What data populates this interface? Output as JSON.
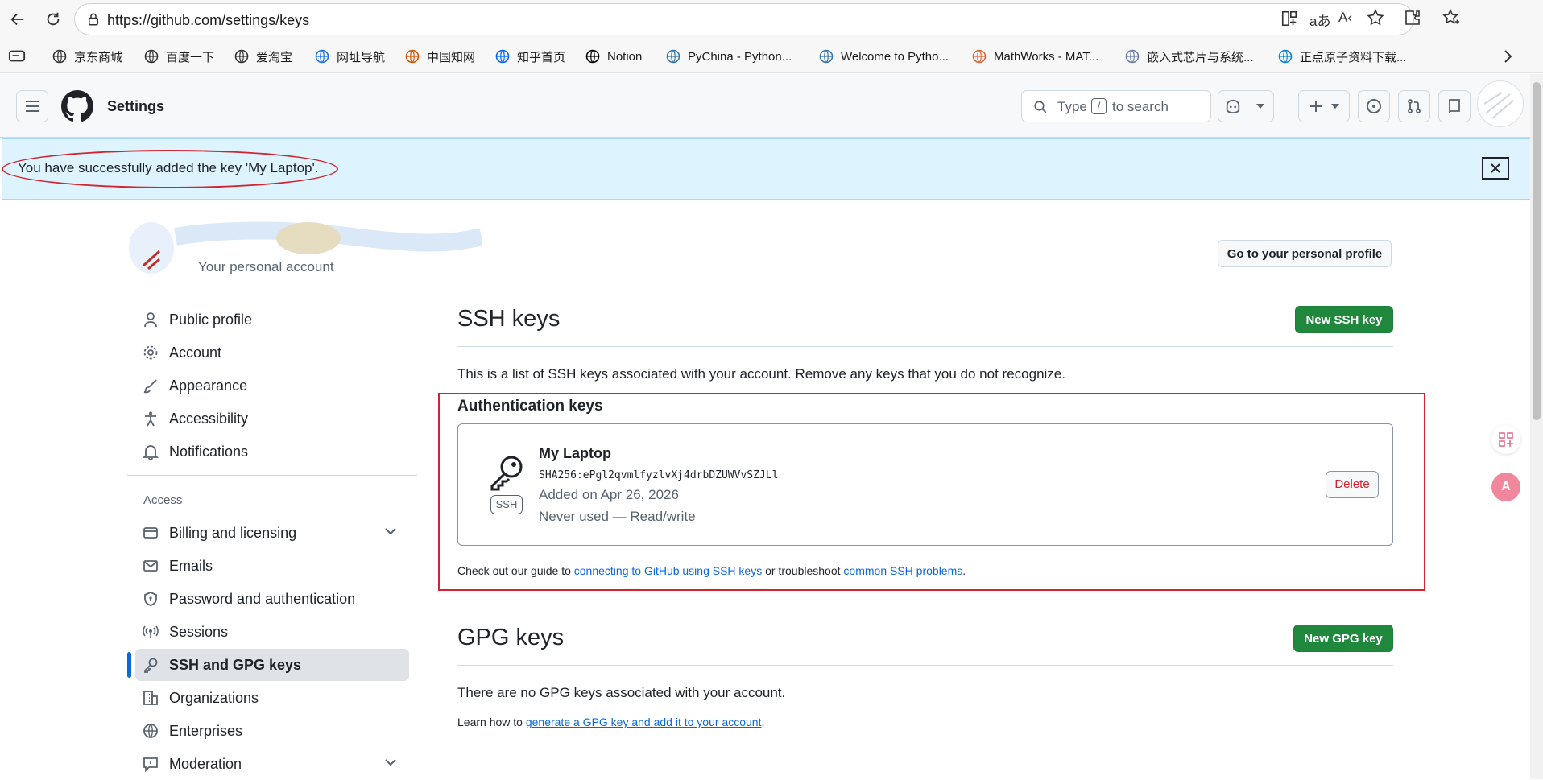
{
  "browser": {
    "url": "https://github.com/settings/keys",
    "bookmarks": [
      {
        "label": "京东商城",
        "icon": "globe-icon"
      },
      {
        "label": "百度一下",
        "icon": "globe-icon"
      },
      {
        "label": "爱淘宝",
        "icon": "globe-icon"
      },
      {
        "label": "网址导航",
        "icon": "sogou-icon"
      },
      {
        "label": "中国知网",
        "icon": "cnki-icon"
      },
      {
        "label": "知乎首页",
        "icon": "zhihu-icon"
      },
      {
        "label": "Notion",
        "icon": "notion-icon"
      },
      {
        "label": "PyChina - Python...",
        "icon": "python-icon"
      },
      {
        "label": "Welcome to Pytho...",
        "icon": "python-icon"
      },
      {
        "label": "MathWorks - MAT...",
        "icon": "matlab-icon"
      },
      {
        "label": "嵌入式芯片与系统...",
        "icon": "chip-icon"
      },
      {
        "label": "正点原子资料下载...",
        "icon": "edge-icon"
      }
    ]
  },
  "header": {
    "title": "Settings",
    "search_type": "Type",
    "search_key": "/",
    "search_suffix": "to search"
  },
  "flash": {
    "message": "You have successfully added the key 'My Laptop'."
  },
  "account": {
    "subtitle": "Your personal account",
    "profile_button": "Go to your personal profile"
  },
  "sidebar": {
    "items": [
      {
        "label": "Public profile",
        "icon": "person-icon"
      },
      {
        "label": "Account",
        "icon": "gear-icon"
      },
      {
        "label": "Appearance",
        "icon": "paintbrush-icon"
      },
      {
        "label": "Accessibility",
        "icon": "accessibility-icon"
      },
      {
        "label": "Notifications",
        "icon": "bell-icon"
      }
    ],
    "access_heading": "Access",
    "access_items": [
      {
        "label": "Billing and licensing",
        "icon": "credit-card-icon"
      },
      {
        "label": "Emails",
        "icon": "mail-icon"
      },
      {
        "label": "Password and authentication",
        "icon": "shield-lock-icon"
      },
      {
        "label": "Sessions",
        "icon": "broadcast-icon"
      },
      {
        "label": "SSH and GPG keys",
        "icon": "key-icon"
      },
      {
        "label": "Organizations",
        "icon": "organization-icon"
      },
      {
        "label": "Enterprises",
        "icon": "globe-icon"
      },
      {
        "label": "Moderation",
        "icon": "report-icon"
      }
    ]
  },
  "ssh": {
    "title": "SSH keys",
    "new_button": "New SSH key",
    "description": "This is a list of SSH keys associated with your account. Remove any keys that you do not recognize.",
    "auth_heading": "Authentication keys",
    "key": {
      "name": "My Laptop",
      "fingerprint": "SHA256:ePgl2qvmlfyzlvXj4drbDZUWVvSZJLl",
      "added": "Added on Apr 26, 2026",
      "usage": "Never used — Read/write",
      "badge": "SSH",
      "delete_label": "Delete"
    },
    "guide_prefix": "Check out our guide to",
    "guide_link1": "connecting to GitHub using SSH keys",
    "guide_middle": "or troubleshoot",
    "guide_link2": "common SSH problems",
    "guide_suffix": "."
  },
  "gpg": {
    "title": "GPG keys",
    "new_button": "New GPG key",
    "description": "There are no GPG keys associated with your account.",
    "learn_prefix": "Learn how to",
    "learn_link": "generate a GPG key and add it to your account",
    "learn_suffix": "."
  },
  "colors": {
    "green": "#1f883d",
    "highlight_red": "#d1242f",
    "link": "#0969da",
    "flash_bg": "#ddf4ff"
  }
}
